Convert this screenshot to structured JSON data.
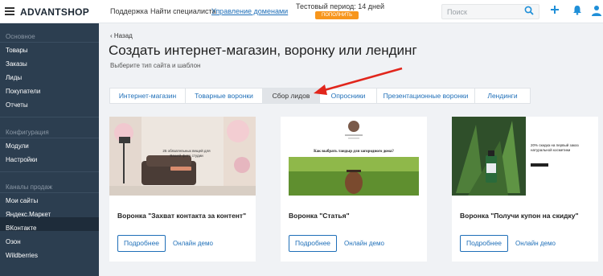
{
  "header": {
    "logo": "ADVANTSHOP",
    "links": [
      "Поддержка",
      "Найти специалиста",
      "Управление доменами"
    ],
    "trial": "Тестовый период: 14 дней",
    "pay_button": "пополнить",
    "search_placeholder": "Поиск"
  },
  "sidebar": {
    "sections": [
      {
        "title": "Основное",
        "items": [
          "Товары",
          "Заказы",
          "Лиды",
          "Покупатели",
          "Отчеты"
        ]
      },
      {
        "title": "Конфигурация",
        "items": [
          "Модули",
          "Настройки"
        ]
      },
      {
        "title": "Каналы продаж",
        "items": [
          "Мои сайты",
          "Яндекс.Маркет",
          "ВКонтакте",
          "Озон",
          "Wildberries"
        ]
      }
    ],
    "active_item": "Мои сайты"
  },
  "main": {
    "back": "Назад",
    "title": "Создать интернет-магазин, воронку или лендинг",
    "subtitle": "Выберите тип сайта и шаблон",
    "tabs": [
      "Интернет-магазин",
      "Товарные воронки",
      "Сбор лидов",
      "Опросники",
      "Презентационные воронки",
      "Лендинги"
    ],
    "active_tab": "Сбор лидов",
    "cards": [
      {
        "name": "Воронка \"Захват контакта за контент\"",
        "more": "Подробнее",
        "demo": "Онлайн демо",
        "preview_text": "25 обязательных вещей для Вашей фото студии"
      },
      {
        "name": "Воронка \"Статья\"",
        "more": "Подробнее",
        "demo": "Онлайн демо",
        "preview_text": "Как выбрать тандыр для загородного дома?"
      },
      {
        "name": "Воронка \"Получи купон на скидку\"",
        "more": "Подробнее",
        "demo": "Онлайн демо",
        "preview_text": "20% скидка на первый заказ натуральной косметики"
      }
    ]
  },
  "colors": {
    "sidebar_bg": "#2c3e50",
    "accent": "#1f6fb8",
    "pay_button": "#f7961d",
    "arrow": "#e1261c"
  }
}
